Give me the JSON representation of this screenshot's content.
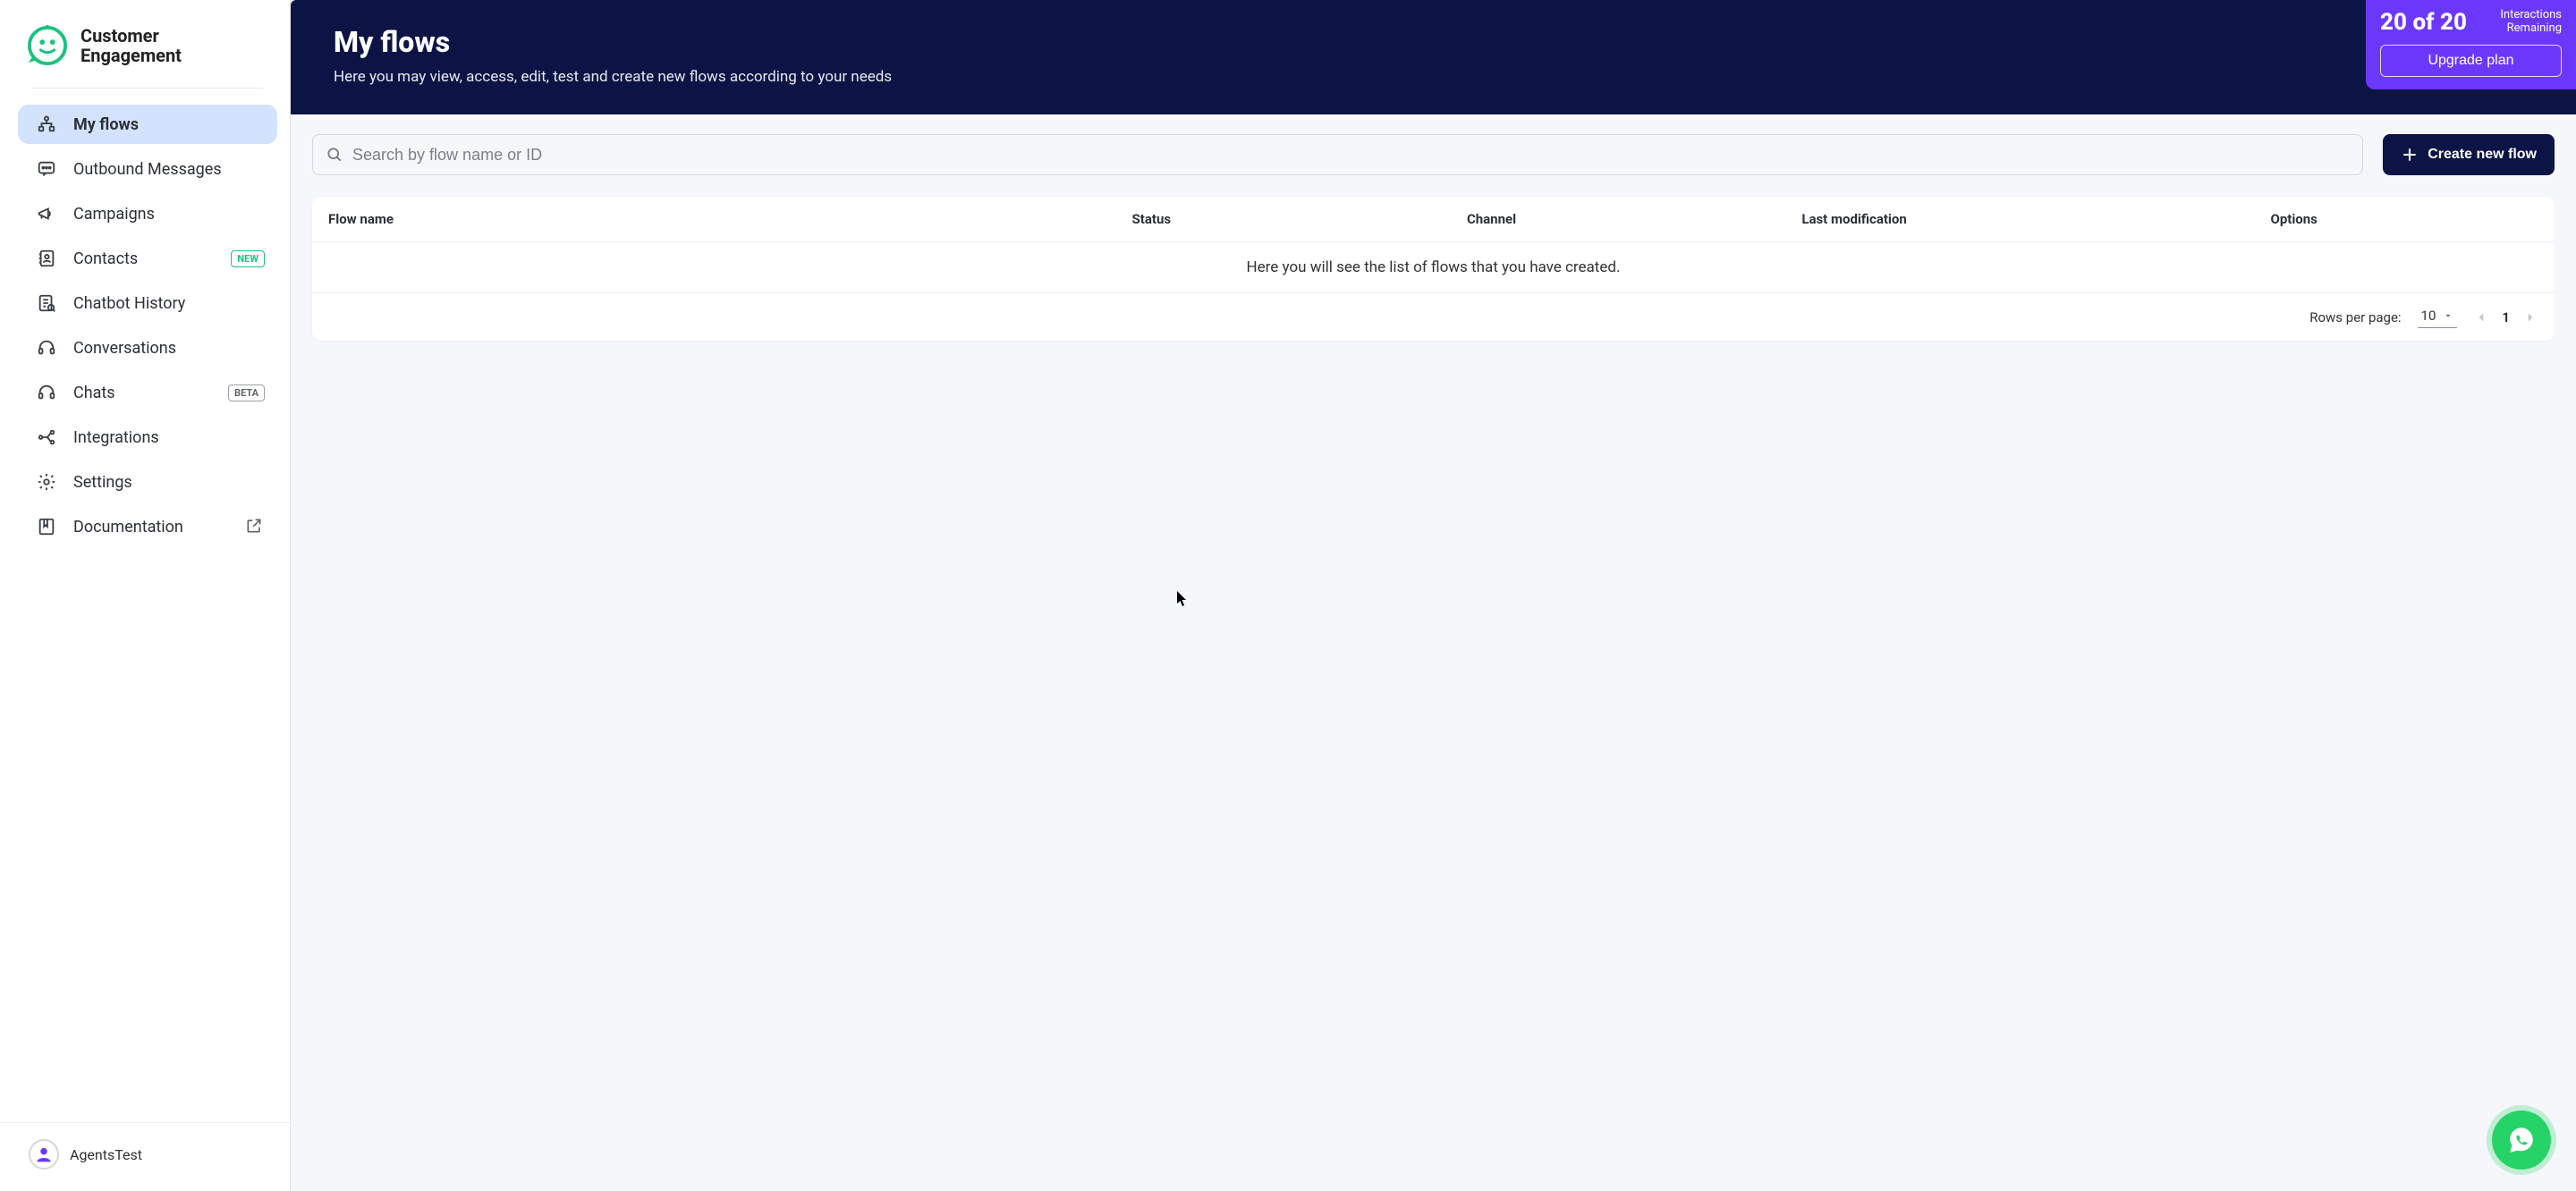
{
  "app": {
    "title_line1": "Customer",
    "title_line2": "Engagement"
  },
  "sidebar": {
    "items": [
      {
        "label": "My flows",
        "active": true
      },
      {
        "label": "Outbound Messages"
      },
      {
        "label": "Campaigns"
      },
      {
        "label": "Contacts",
        "badge": "NEW"
      },
      {
        "label": "Chatbot History"
      },
      {
        "label": "Conversations"
      },
      {
        "label": "Chats",
        "badge": "BETA",
        "badge_kind": "beta"
      },
      {
        "label": "Integrations"
      },
      {
        "label": "Settings"
      },
      {
        "label": "Documentation",
        "external": true
      }
    ]
  },
  "user": {
    "name": "AgentsTest"
  },
  "hero": {
    "title": "My flows",
    "subtitle": "Here you may view, access, edit, test and create new flows according to your needs"
  },
  "plan": {
    "count_text": "20 of 20",
    "label_line1": "Interactions",
    "label_line2": "Remaining",
    "upgrade_label": "Upgrade plan"
  },
  "search": {
    "placeholder": "Search by flow name or ID"
  },
  "create_button": "Create new flow",
  "table": {
    "columns": {
      "c0": "Flow name",
      "c1": "Status",
      "c2": "Channel",
      "c3": "Last modification",
      "c4": "Options"
    },
    "empty_text": "Here you will see the list of flows that you have created.",
    "rows_label": "Rows per page:",
    "rows_value": "10",
    "page_current": "1"
  },
  "colors": {
    "accent_purple": "#6b38fb",
    "brand_green": "#19c37d",
    "hero_navy": "#0c1445",
    "whatsapp_green": "#25d366"
  }
}
